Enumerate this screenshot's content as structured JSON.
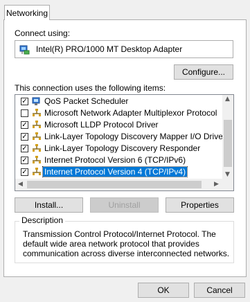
{
  "tab": {
    "label": "Networking"
  },
  "connect_using": {
    "label": "Connect using:",
    "adapter": "Intel(R) PRO/1000 MT Desktop Adapter",
    "configure_label": "Configure..."
  },
  "items_section": {
    "label": "This connection uses the following items:",
    "items": [
      {
        "label": "QoS Packet Scheduler",
        "checked": true,
        "icon": "qos-icon"
      },
      {
        "label": "Microsoft Network Adapter Multiplexor Protocol",
        "checked": false,
        "icon": "protocol-icon"
      },
      {
        "label": "Microsoft LLDP Protocol Driver",
        "checked": true,
        "icon": "protocol-icon"
      },
      {
        "label": "Link-Layer Topology Discovery Mapper I/O Driver",
        "checked": true,
        "icon": "protocol-icon"
      },
      {
        "label": "Link-Layer Topology Discovery Responder",
        "checked": true,
        "icon": "protocol-icon"
      },
      {
        "label": "Internet Protocol Version 6 (TCP/IPv6)",
        "checked": true,
        "icon": "protocol-icon"
      },
      {
        "label": "Internet Protocol Version 4 (TCP/IPv4)",
        "checked": true,
        "icon": "protocol-icon",
        "selected": true
      }
    ]
  },
  "buttons": {
    "install": "Install...",
    "uninstall": "Uninstall",
    "properties": "Properties"
  },
  "description": {
    "title": "Description",
    "text": "Transmission Control Protocol/Internet Protocol. The default wide area network protocol that provides communication across diverse interconnected networks."
  },
  "dialog": {
    "ok": "OK",
    "cancel": "Cancel"
  },
  "colors": {
    "selection": "#0078d7",
    "button_face": "#e1e1e1",
    "border": "#adadad"
  }
}
